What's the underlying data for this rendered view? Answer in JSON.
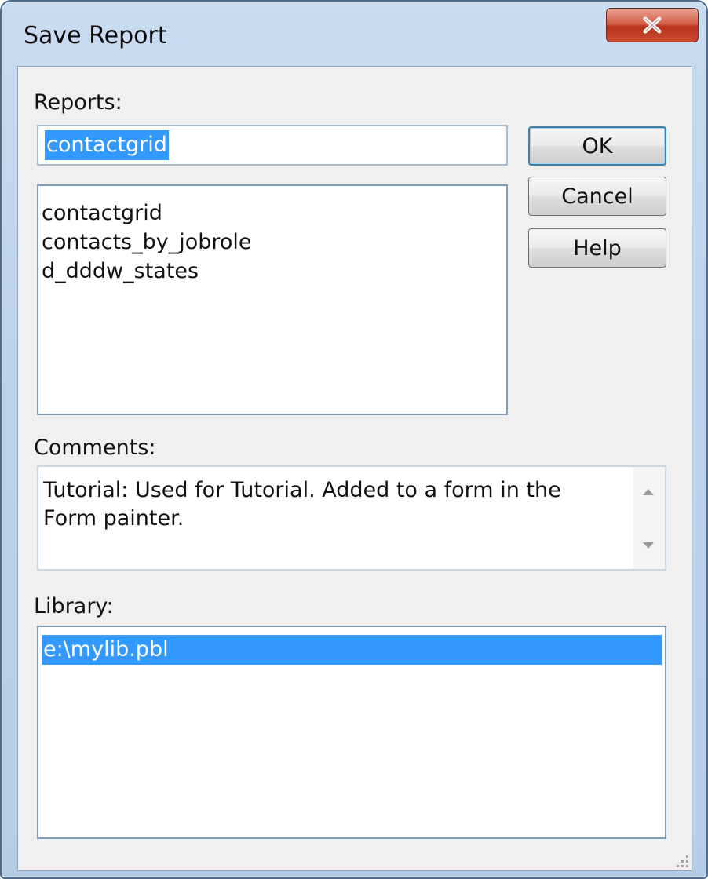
{
  "window": {
    "title": "Save Report",
    "close_label": "X"
  },
  "reports": {
    "label": "Reports:",
    "name_value": "contactgrid",
    "items": [
      "contactgrid",
      "contacts_by_jobrole",
      "d_dddw_states"
    ]
  },
  "buttons": {
    "ok": "OK",
    "cancel": "Cancel",
    "help": "Help"
  },
  "comments": {
    "label": "Comments:",
    "text": "Tutorial: Used for Tutorial. Added to a form in the Form painter."
  },
  "library": {
    "label": "Library:",
    "items": [
      "e:\\mylib.pbl"
    ],
    "selected": "e:\\mylib.pbl"
  },
  "colors": {
    "selection": "#3399ff",
    "close_button": "#c94b33",
    "frame": "#bdd3ec",
    "client": "#f0f0f0"
  },
  "icons": [
    "close-icon",
    "scroll-up-icon",
    "scroll-down-icon",
    "resize-grip-icon"
  ]
}
